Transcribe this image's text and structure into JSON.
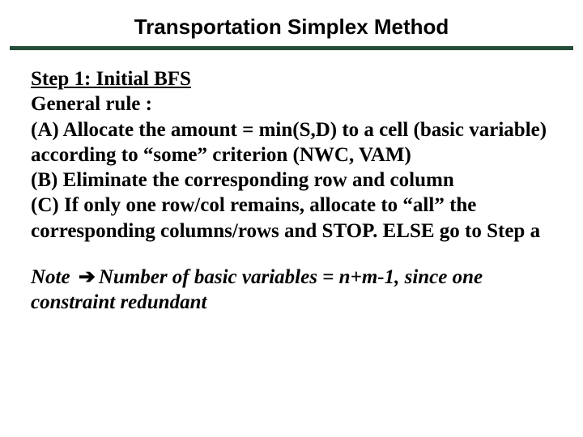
{
  "title": "Transportation Simplex Method",
  "step_label": "Step 1: Initial BFS",
  "general_rule_label": "General rule :",
  "item_a": "(A) Allocate the amount = min(S,D) to a cell (basic variable) according to “some” criterion (NWC, VAM)",
  "item_b": "(B) Eliminate the corresponding row and column",
  "item_c": "(C) If only one row/col remains, allocate to “all” the corresponding columns/rows and STOP.  ELSE go to Step a",
  "note_prefix": "Note",
  "arrow_glyph": "➔",
  "note_text": "Number of basic variables = n+m-1, since one constraint redundant"
}
